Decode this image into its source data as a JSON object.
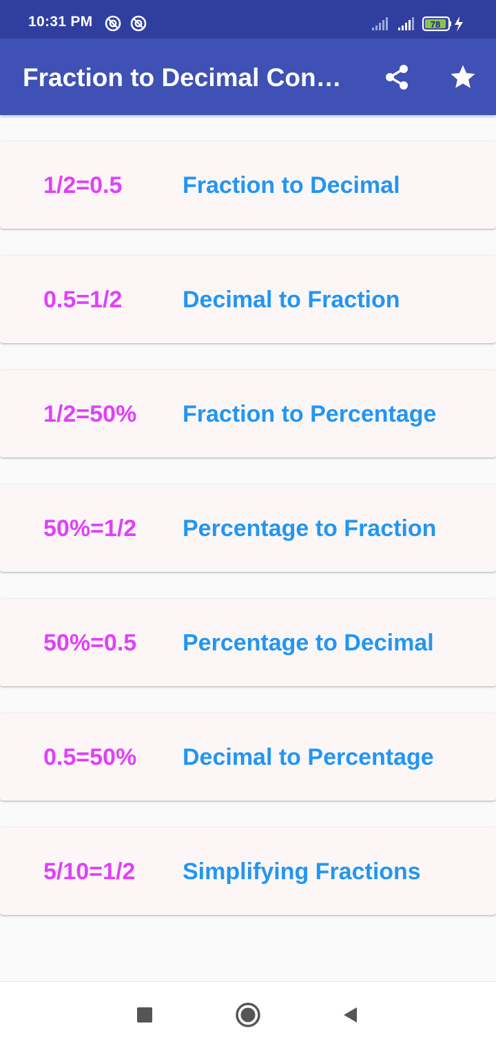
{
  "status_bar": {
    "time": "10:31 PM",
    "battery": "78",
    "icons": [
      "sync-icon",
      "sync-icon",
      "signal-icon",
      "signal-icon",
      "battery-icon",
      "charging-icon"
    ]
  },
  "app_bar": {
    "title": "Fraction to Decimal Conv…",
    "actions": [
      "share-icon",
      "star-icon"
    ]
  },
  "menu": {
    "items": [
      {
        "example": "1/2=0.5",
        "label": "Fraction to Decimal"
      },
      {
        "example": "0.5=1/2",
        "label": "Decimal to Fraction"
      },
      {
        "example": "1/2=50%",
        "label": "Fraction to Percentage"
      },
      {
        "example": "50%=1/2",
        "label": "Percentage to Fraction"
      },
      {
        "example": "50%=0.5",
        "label": "Percentage to Decimal"
      },
      {
        "example": "0.5=50%",
        "label": "Decimal to Percentage"
      },
      {
        "example": "5/10=1/2",
        "label": "Simplifying Fractions"
      }
    ]
  },
  "nav_bar": {
    "buttons": [
      "recents-icon",
      "home-icon",
      "back-icon"
    ]
  },
  "colors": {
    "status_bar": "#303f9f",
    "app_bar": "#3f51b5",
    "example_text": "#e040fb",
    "label_text": "#2196f3",
    "card_bg": "#fdf6f7",
    "page_bg": "#fafafa"
  }
}
